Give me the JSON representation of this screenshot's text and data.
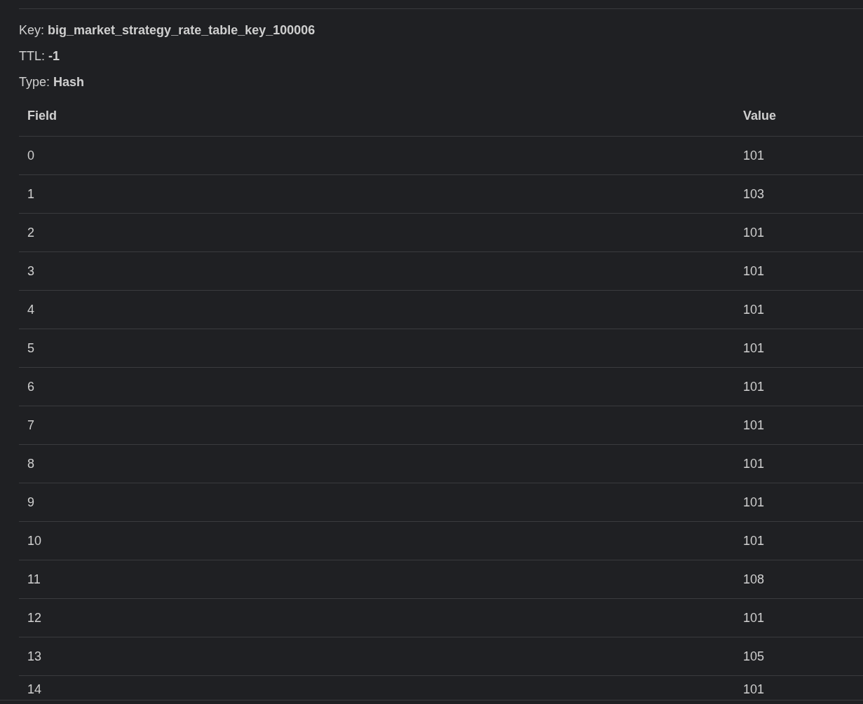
{
  "details": [
    {
      "label": "Key:",
      "value": "big_market_strategy_rate_table_key_100006"
    },
    {
      "label": "TTL:",
      "value": "-1"
    },
    {
      "label": "Type:",
      "value": "Hash"
    }
  ],
  "table": {
    "columns": [
      "Field",
      "Value"
    ],
    "rows": [
      [
        "0",
        "101"
      ],
      [
        "1",
        "103"
      ],
      [
        "2",
        "101"
      ],
      [
        "3",
        "101"
      ],
      [
        "4",
        "101"
      ],
      [
        "5",
        "101"
      ],
      [
        "6",
        "101"
      ],
      [
        "7",
        "101"
      ],
      [
        "8",
        "101"
      ],
      [
        "9",
        "101"
      ],
      [
        "10",
        "101"
      ],
      [
        "11",
        "108"
      ],
      [
        "12",
        "101"
      ],
      [
        "13",
        "105"
      ],
      [
        "14",
        "101"
      ]
    ]
  }
}
